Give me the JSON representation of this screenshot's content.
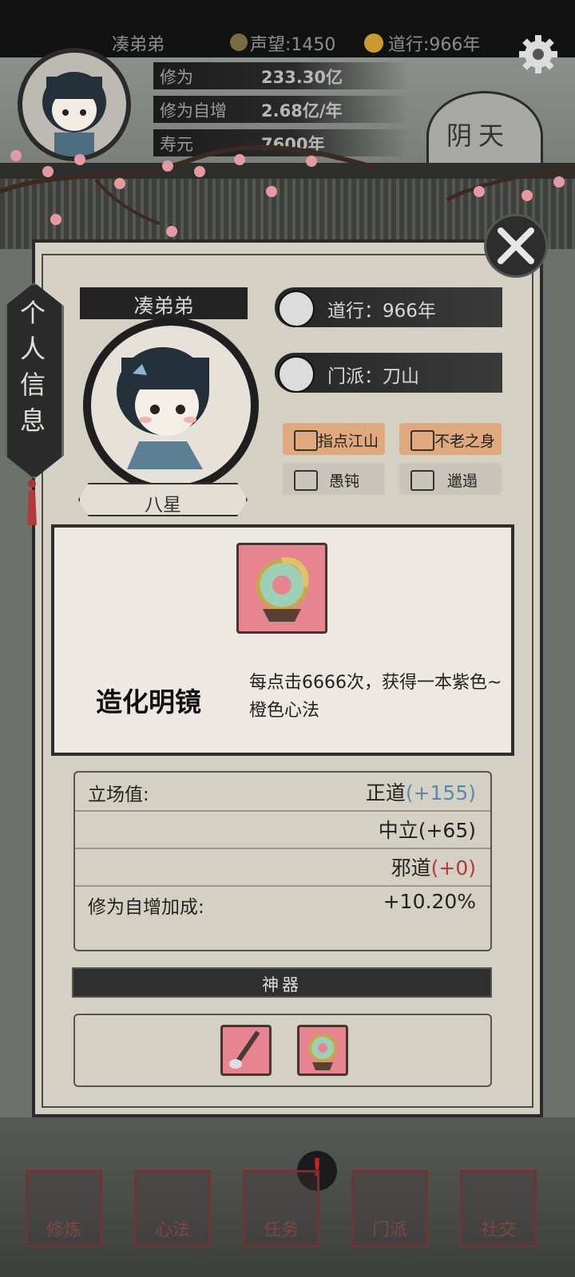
{
  "top": {
    "player_name": "凑弟弟",
    "prestige_label": "声望:1450",
    "daoxing_label": "道行:966年",
    "cultivation_label": "修为",
    "cultivation_value": "233.30亿",
    "growth_label": "修为自增",
    "growth_value": "2.68亿/年",
    "lifespan_label": "寿元",
    "lifespan_value": "7600年",
    "weather": "阴天"
  },
  "side_tab": {
    "label": "个人信息"
  },
  "profile": {
    "name": "凑弟弟",
    "rank": "八星",
    "daoxing": "道行：966年",
    "sect": "门派：刀山",
    "traits": [
      "指点江山",
      "不老之身",
      "愚钝",
      "邋遢"
    ]
  },
  "card": {
    "title": "造化明镜",
    "description": "每点击6666次，获得一本紫色~橙色心法"
  },
  "stats": {
    "stance_label": "立场值:",
    "righteous": "正道",
    "righteous_val": "(+155)",
    "neutral": "中立(+65)",
    "evil": "邪道",
    "evil_val": "(+0)",
    "growth_bonus_label": "修为自增加成:",
    "growth_bonus_value": "+10.20%"
  },
  "artifacts": {
    "header": "神器"
  },
  "nav": [
    "修炼",
    "心法",
    "任务",
    "门派",
    "社交"
  ],
  "colors": {
    "trait_good": "#e0a97d",
    "trait_bad": "#c9c5bc",
    "righteous": "#5a8aa8",
    "evil": "#b23a3a"
  }
}
